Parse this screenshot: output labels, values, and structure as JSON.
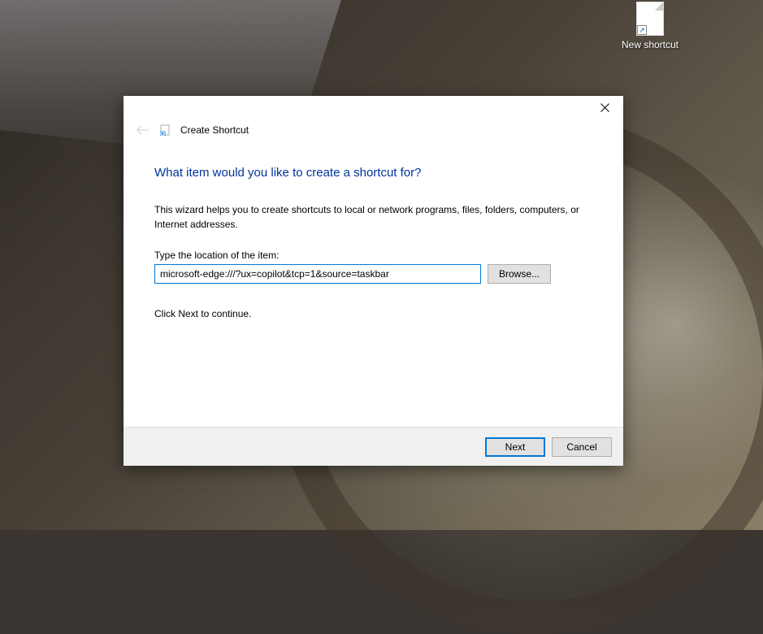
{
  "desktop": {
    "icon_label": "New shortcut"
  },
  "dialog": {
    "title": "Create Shortcut",
    "heading": "What item would you like to create a shortcut for?",
    "description": "This wizard helps you to create shortcuts to local or network programs, files, folders, computers, or Internet addresses.",
    "input_label": "Type the location of the item:",
    "input_value": "microsoft-edge:///?ux=copilot&tcp=1&source=taskbar",
    "browse_label": "Browse...",
    "continue_text": "Click Next to continue.",
    "next_label": "Next",
    "cancel_label": "Cancel"
  }
}
